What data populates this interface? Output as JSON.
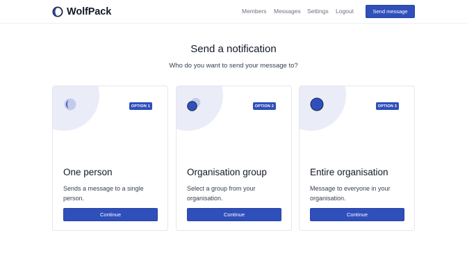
{
  "app": {
    "brand_name": "WolfPack",
    "brand_color": "#2f4fba"
  },
  "nav": {
    "links": [
      "Members",
      "Messages",
      "Settings",
      "Logout"
    ],
    "cta_label": "Send message"
  },
  "main": {
    "title": "Send a notification",
    "subtitle": "Who do you want to send your message to?"
  },
  "options": [
    {
      "badge": "OPTION 1",
      "icon": "single-person-icon",
      "title": "One person",
      "description": "Sends a message to a single person.",
      "button": "Continue"
    },
    {
      "badge": "OPTION 2",
      "icon": "group-icon",
      "title": "Organisation group",
      "description": "Select a group from your organisation.",
      "button": "Continue"
    },
    {
      "badge": "OPTION 3",
      "icon": "organisation-icon",
      "title": "Entire organisation",
      "description": "Message to everyone in your organisation.",
      "button": "Continue"
    }
  ]
}
